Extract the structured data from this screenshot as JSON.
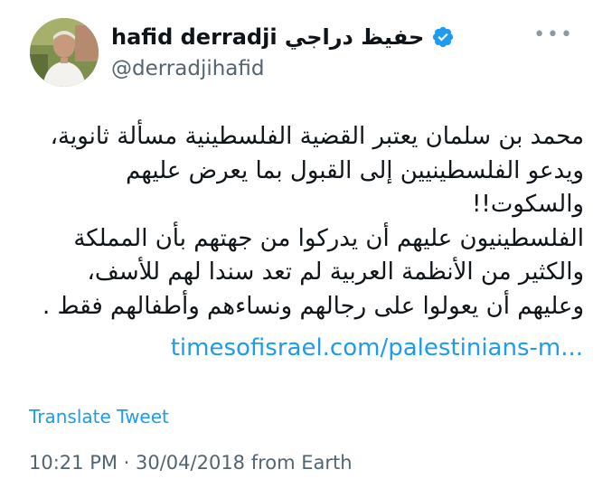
{
  "author": {
    "display_name": "hafid derradji حفيظ دراجي",
    "handle": "@derradjihafid",
    "verified": true,
    "avatar_icon": "profile-photo"
  },
  "menu": {
    "more_label": "•••"
  },
  "tweet": {
    "paragraph_1": "محمد بن سلمان يعتبر القضية الفلسطينية مسألة ثانوية، ويدعو الفلسطينيين إلى القبول بما يعرض عليهم والسكوت!!",
    "paragraph_2": "الفلسطينيون عليهم أن يدركوا من جهتهم بأن المملكة والكثير من الأنظمة العربية لم تعد سندا لهم للأسف، وعليهم أن يعولوا على رجالهم ونساءهم وأطفالهم فقط .",
    "link_text": "timesofisrael.com/palestinians-m..."
  },
  "translate_label": "Translate Tweet",
  "meta": {
    "timestamp": "10:21 PM · 30/04/2018 from Earth"
  },
  "colors": {
    "accent": "#1d9bf0",
    "secondary_text": "#536471",
    "primary_text": "#0f1419"
  }
}
